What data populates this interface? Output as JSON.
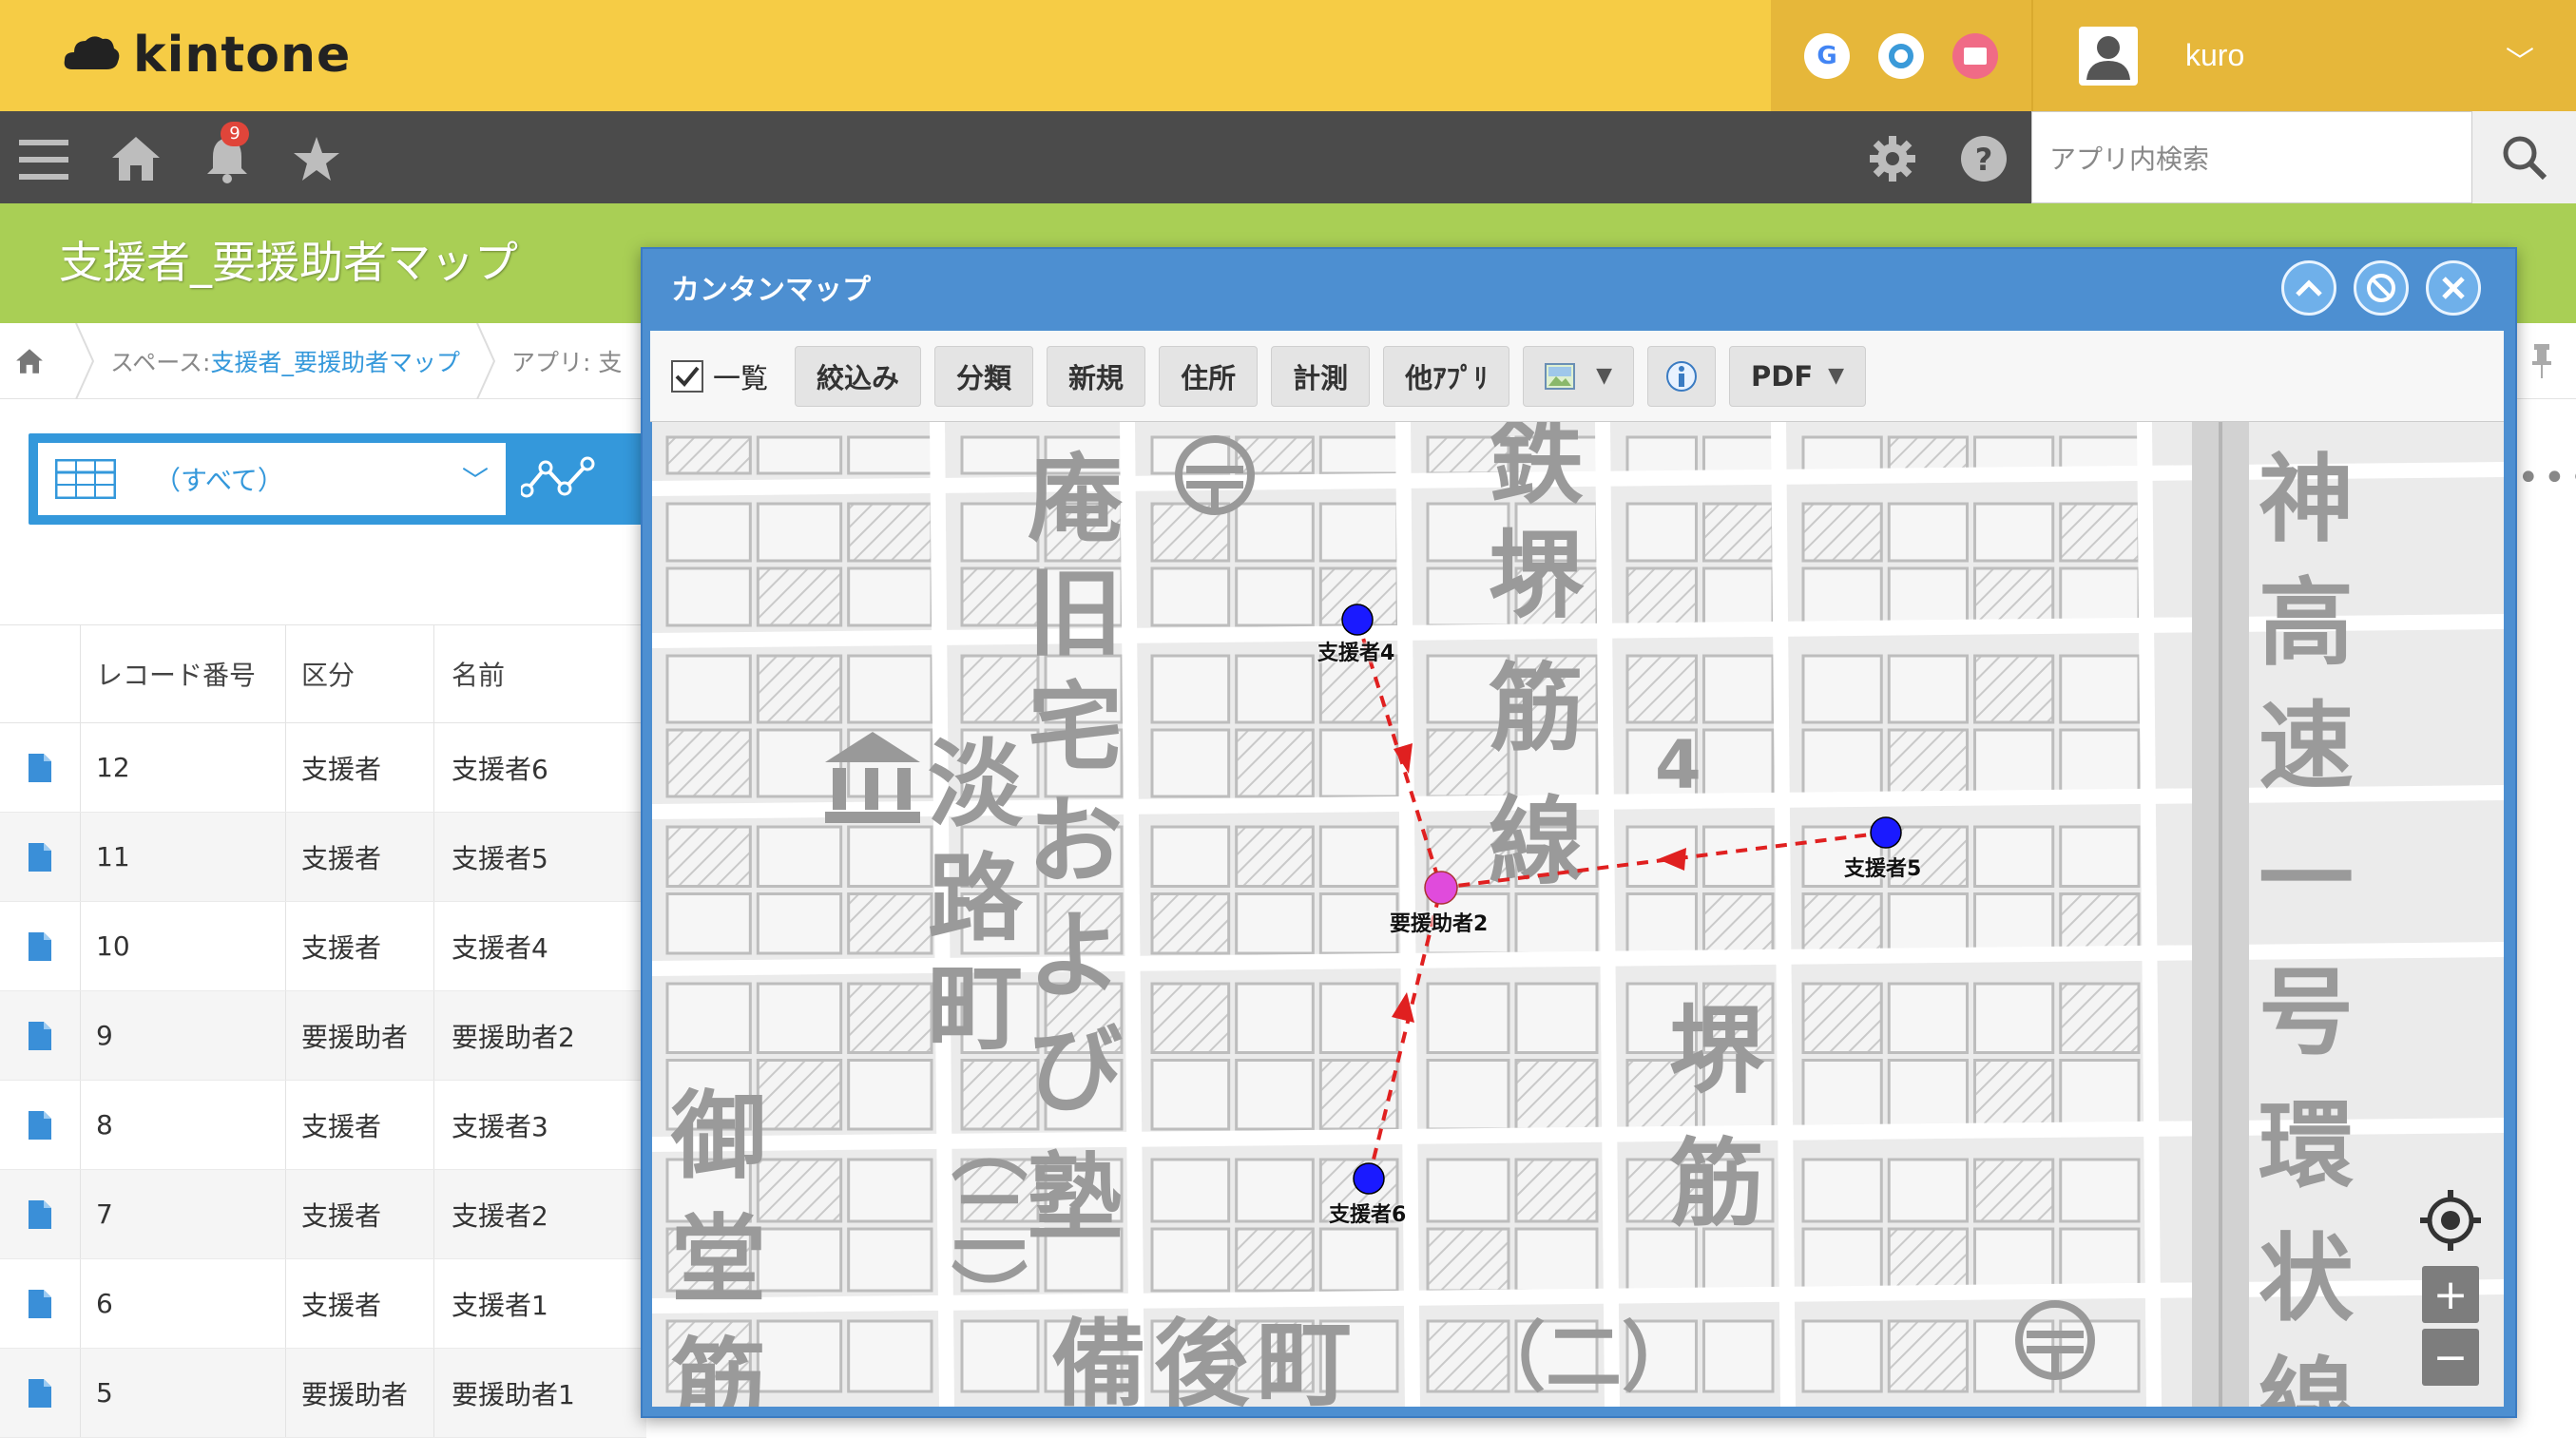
{
  "header": {
    "logo_text": "kintone",
    "user_name": "kuro",
    "top_icons": [
      "google-icon",
      "garoon-icon",
      "mail-icon"
    ]
  },
  "nav": {
    "notification_count": "9",
    "search_placeholder": "アプリ内検索"
  },
  "app": {
    "title": "支援者_要援助者マップ"
  },
  "breadcrumb": {
    "space_label": "スペース: ",
    "space_name": "支援者_要援助者マップ",
    "app_label": "アプリ: 支"
  },
  "view": {
    "selected": "（すべて）"
  },
  "table": {
    "columns": [
      "レコード番号",
      "区分",
      "名前"
    ],
    "rows": [
      {
        "id": "12",
        "kind": "支援者",
        "name": "支援者6"
      },
      {
        "id": "11",
        "kind": "支援者",
        "name": "支援者5"
      },
      {
        "id": "10",
        "kind": "支援者",
        "name": "支援者4"
      },
      {
        "id": "9",
        "kind": "要援助者",
        "name": "要援助者2"
      },
      {
        "id": "8",
        "kind": "支援者",
        "name": "支援者3"
      },
      {
        "id": "7",
        "kind": "支援者",
        "name": "支援者2"
      },
      {
        "id": "6",
        "kind": "支援者",
        "name": "支援者1"
      },
      {
        "id": "5",
        "kind": "要援助者",
        "name": "要援助者1"
      }
    ]
  },
  "dialog": {
    "title": "カンタンマップ",
    "toolbar": {
      "list_label": "一覧",
      "filter": "絞込み",
      "classify": "分類",
      "new": "新規",
      "address": "住所",
      "measure": "計測",
      "other_app": "他ｱﾌﾟﾘ",
      "pdf": "PDF"
    },
    "map": {
      "markers": {
        "supporter4": "支援者4",
        "supporter5": "支援者5",
        "supporter6": "支援者6",
        "needs_help2": "要援助者2"
      },
      "labels": {
        "l_an": "庵",
        "l_kyu": "旧",
        "l_taku": "宅",
        "l_o": "お",
        "l_yo": "よ",
        "l_bi": "び",
        "l_juku": "塾",
        "l_awaji": "淡",
        "l_ro": "路",
        "l_machi1": "町",
        "l_paren2": "（二）",
        "l_mi": "御",
        "l_do": "堂",
        "l_suji1": "筋",
        "l_sakai1": "堺",
        "l_suji2": "筋",
        "l_sen": "線",
        "l_tetsu": "鉄",
        "l_4": "4",
        "l_sakai2": "堺",
        "l_suji3": "筋",
        "l_bingo": "備後町",
        "l_bingo2": "（二）",
        "l_kami": "神",
        "l_taka": "高",
        "l_soku": "速",
        "l_ichi": "一",
        "l_go": "号",
        "l_kan": "環",
        "l_jo": "状",
        "l_sen2": "線"
      }
    }
  },
  "colors": {
    "topbar": "#f6cc45",
    "navbar": "#4b4b4b",
    "apphead": "#a9cf55",
    "accent": "#3498db",
    "dialog": "#4d8fd1",
    "marker_supporter": "#1a1aff",
    "marker_needs_help": "#e04bdc",
    "route_line": "#e02020"
  }
}
